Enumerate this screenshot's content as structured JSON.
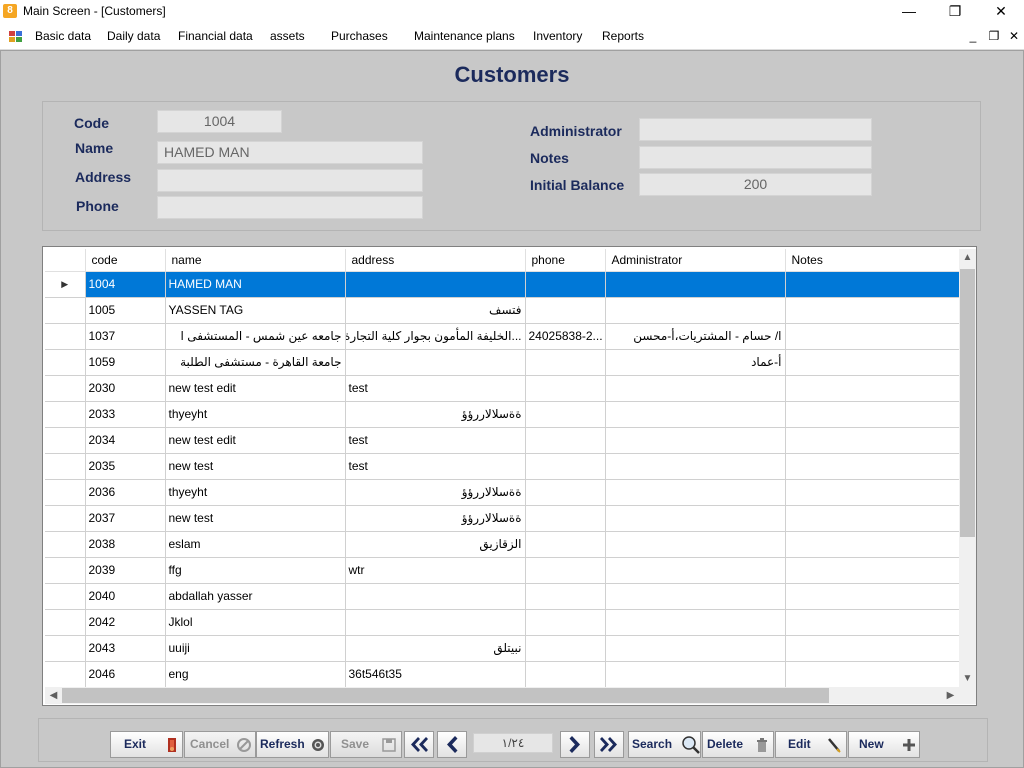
{
  "window": {
    "title": "Main Screen - [Customers]"
  },
  "menu": [
    {
      "label": "Basic data"
    },
    {
      "label": "Daily data"
    },
    {
      "label": "Financial data"
    },
    {
      "label": "assets"
    },
    {
      "label": "Purchases"
    },
    {
      "label": "Maintenance plans"
    },
    {
      "label": "Inventory"
    },
    {
      "label": "Reports"
    }
  ],
  "page_title": "Customers",
  "form": {
    "code_label": "Code",
    "code_value": "1004",
    "name_label": "Name",
    "name_value": "HAMED MAN",
    "address_label": "Address",
    "address_value": "",
    "phone_label": "Phone",
    "phone_value": "",
    "administrator_label": "Administrator",
    "administrator_value": "",
    "notes_label": "Notes",
    "notes_value": "",
    "balance_label": "Initial Balance",
    "balance_value": "200"
  },
  "grid": {
    "columns": [
      "code",
      "name",
      "address",
      "phone",
      "Administrator",
      "Notes"
    ],
    "selected_row": 0,
    "rows": [
      {
        "code": "1004",
        "name": "HAMED MAN",
        "address": "",
        "phone": "",
        "administrator": "",
        "notes": ""
      },
      {
        "code": "1005",
        "name": "YASSEN TAG",
        "address": "فتسف",
        "phone": "",
        "administrator": "",
        "notes": ""
      },
      {
        "code": "1037",
        "name": "جامعه عين شمس - المستشفى ا",
        "address": "...الخليفة المأمون بجوار كلية التجارة ع",
        "phone": "24025838-2...",
        "administrator": "ا/ حسام - المشتريات،أ-محسن",
        "notes": ""
      },
      {
        "code": "1059",
        "name": "جامعة القاهرة - مستشفى الطلبة",
        "address": "",
        "phone": "",
        "administrator": "أ-عماد",
        "notes": ""
      },
      {
        "code": "2030",
        "name": "new test edit",
        "address": "test",
        "phone": "",
        "administrator": "",
        "notes": ""
      },
      {
        "code": "2033",
        "name": "thyeyht",
        "address": "ةةسلالاررؤؤ",
        "phone": "",
        "administrator": "",
        "notes": ""
      },
      {
        "code": "2034",
        "name": "new test edit",
        "address": "test",
        "phone": "",
        "administrator": "",
        "notes": ""
      },
      {
        "code": "2035",
        "name": "new test",
        "address": "test",
        "phone": "",
        "administrator": "",
        "notes": ""
      },
      {
        "code": "2036",
        "name": "thyeyht",
        "address": "ةةسلالاررؤؤ",
        "phone": "",
        "administrator": "",
        "notes": ""
      },
      {
        "code": "2037",
        "name": "new test",
        "address": "ةةسلالاررؤؤ",
        "phone": "",
        "administrator": "",
        "notes": ""
      },
      {
        "code": "2038",
        "name": "eslam",
        "address": "الزقازيق",
        "phone": "",
        "administrator": "",
        "notes": ""
      },
      {
        "code": "2039",
        "name": "ffg",
        "address": "wtr",
        "phone": "",
        "administrator": "",
        "notes": ""
      },
      {
        "code": "2040",
        "name": "abdallah yasser",
        "address": "",
        "phone": "",
        "administrator": "",
        "notes": ""
      },
      {
        "code": "2042",
        "name": "Jklol",
        "address": "",
        "phone": "",
        "administrator": "",
        "notes": ""
      },
      {
        "code": "2043",
        "name": "uuiji",
        "address": "نبيتلق",
        "phone": "",
        "administrator": "",
        "notes": ""
      },
      {
        "code": "2046",
        "name": "eng",
        "address": "36t546t35",
        "phone": "",
        "administrator": "",
        "notes": ""
      },
      {
        "code": "",
        "name": "",
        "address": "",
        "phone": "",
        "administrator": "",
        "notes": ""
      }
    ]
  },
  "toolbar": {
    "exit_label": "Exit",
    "cancel_label": "Cancel",
    "refresh_label": "Refresh",
    "save_label": "Save",
    "pager_value": "١/٢٤",
    "search_label": "Search",
    "delete_label": "Delete",
    "edit_label": "Edit",
    "new_label": "New"
  },
  "icons": {
    "app": "app-icon",
    "first": "double-left-arrow-icon",
    "prev": "left-arrow-icon",
    "next": "right-arrow-icon",
    "last": "double-right-arrow-icon",
    "search": "magnifier-icon",
    "delete": "trash-icon",
    "edit": "pencil-icon",
    "new": "plus-icon"
  },
  "colors": {
    "title": "#1b2a5c",
    "selection": "#0078d7",
    "client_bg": "#c8c8c8"
  }
}
